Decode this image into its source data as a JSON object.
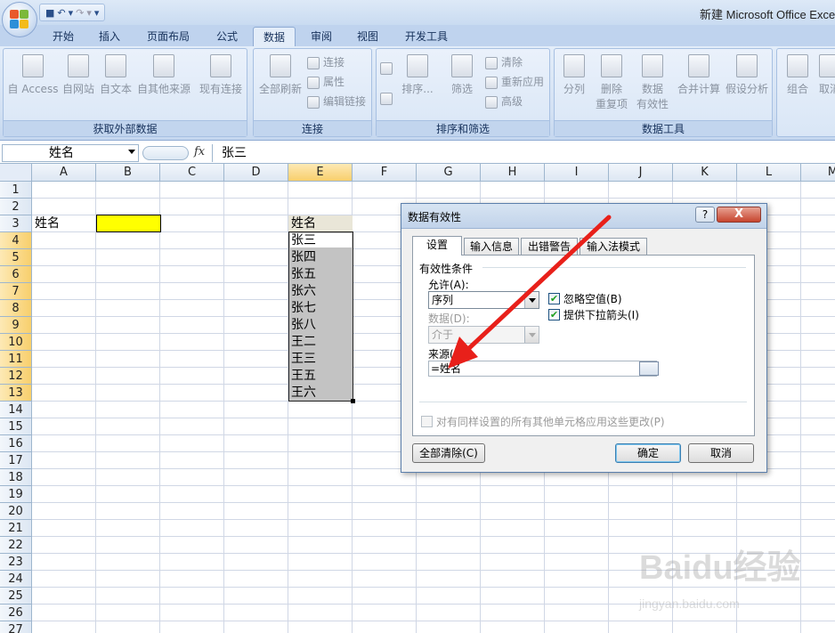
{
  "window": {
    "title": "新建 Microsoft Office Excel"
  },
  "tabs": [
    "开始",
    "插入",
    "页面布局",
    "公式",
    "数据",
    "审阅",
    "视图",
    "开发工具"
  ],
  "ribbon": {
    "get_external_data": {
      "label": "获取外部数据",
      "buttons": [
        "自 Access",
        "自网站",
        "自文本",
        "自其他来源",
        "现有连接"
      ]
    },
    "connections": {
      "label": "连接",
      "refresh_all": "全部刷新",
      "small": [
        "连接",
        "属性",
        "编辑链接"
      ]
    },
    "sort_filter": {
      "label": "排序和筛选",
      "sort": "排序...",
      "filter": "筛选",
      "small": [
        "清除",
        "重新应用",
        "高级"
      ]
    },
    "data_tools": {
      "label": "数据工具",
      "text_to_columns": "分列",
      "remove_dup_line1": "删除",
      "remove_dup_line2": "重复项",
      "validation_line1": "数据",
      "validation_line2": "有效性",
      "consolidate": "合并计算",
      "what_if": "假设分析"
    },
    "outline": {
      "group": "组合",
      "ungroup": "取消"
    }
  },
  "formula_bar": {
    "name_box": "姓名",
    "fx": "fx",
    "value": "张三"
  },
  "sheet": {
    "columns": [
      "A",
      "B",
      "C",
      "D",
      "E",
      "F",
      "G",
      "H",
      "I",
      "J",
      "K",
      "L",
      "M"
    ],
    "rows": [
      "1",
      "2",
      "3",
      "4",
      "5",
      "6",
      "7",
      "8",
      "9",
      "10",
      "11",
      "12",
      "13",
      "14",
      "15",
      "16",
      "17",
      "18",
      "19",
      "20",
      "21",
      "22",
      "23",
      "24",
      "25",
      "26",
      "27"
    ],
    "a3": "姓名",
    "e3": "姓名",
    "names": [
      "张三",
      "张四",
      "张五",
      "张六",
      "张七",
      "张八",
      "王二",
      "王三",
      "王五",
      "王六"
    ]
  },
  "dialog": {
    "title": "数据有效性",
    "help": "?",
    "close": "X",
    "tabs": [
      "设置",
      "输入信息",
      "出错警告",
      "输入法模式"
    ],
    "criteria_title": "有效性条件",
    "allow_label": "允许(A):",
    "allow_value": "序列",
    "data_label": "数据(D):",
    "data_value": "介于",
    "ignore_blank": "忽略空值(B)",
    "in_cell_dropdown": "提供下拉箭头(I)",
    "source_label": "来源(S):",
    "source_value": "=姓名",
    "apply_all": "对有同样设置的所有其他单元格应用这些更改(P)",
    "clear_all": "全部清除(C)",
    "ok": "确定",
    "cancel": "取消"
  },
  "watermark": {
    "brand": "Baidu经验",
    "url": "jingyan.baidu.com"
  },
  "colors": {
    "highlight_cell": "#ffff00",
    "arrow": "#e8201a"
  }
}
